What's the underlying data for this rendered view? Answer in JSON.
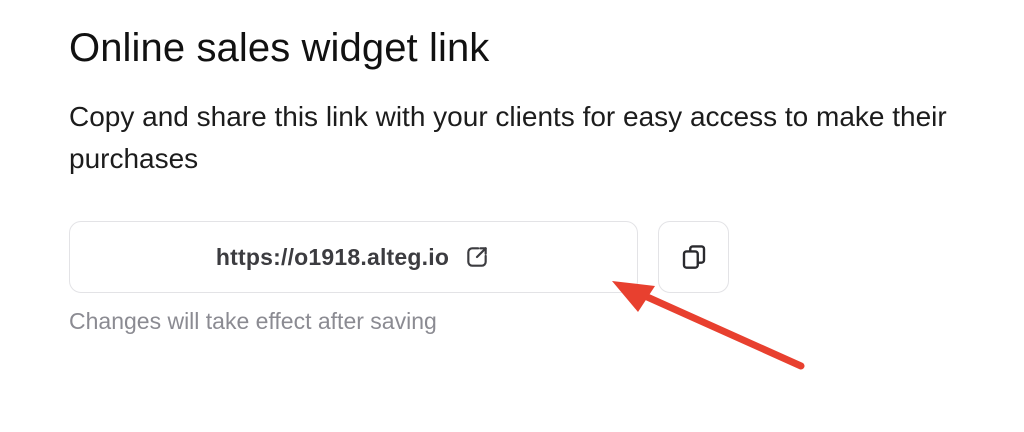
{
  "section": {
    "title": "Online sales widget link",
    "description": "Copy and share this link with your clients for easy access to make their purchases",
    "link": {
      "url": "https://o1918.alteg.io",
      "icon": "external-link-icon"
    },
    "copy_button": {
      "icon": "copy-icon"
    },
    "hint": "Changes will take effect after saving"
  },
  "annotation": {
    "arrow_color": "#e8402f"
  },
  "colors": {
    "text": "#111111",
    "muted": "#8b8b92",
    "border": "#e3e3e6"
  }
}
